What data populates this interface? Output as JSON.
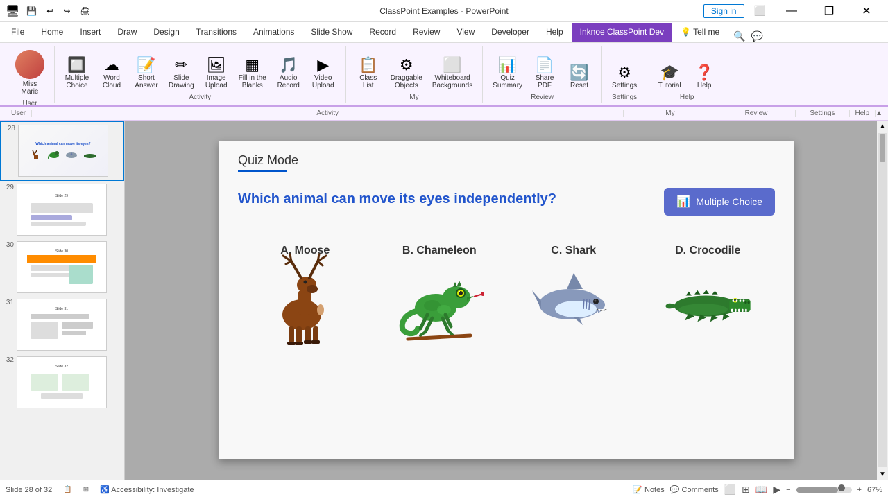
{
  "titlebar": {
    "title": "ClassPoint Examples - PowerPoint",
    "signIn": "Sign in",
    "buttons": {
      "minimize": "—",
      "maximize": "❐",
      "close": "✕"
    }
  },
  "quickaccess": [
    "💾",
    "↩",
    "↪",
    "🖨",
    "✎"
  ],
  "ribbon": {
    "activeTab": "Inknoe ClassPoint Dev",
    "tabs": [
      "File",
      "Home",
      "Insert",
      "Draw",
      "Design",
      "Transitions",
      "Animations",
      "Slide Show",
      "Record",
      "Review",
      "View",
      "Developer",
      "Help",
      "Inknoe ClassPoint Dev",
      "Tell me"
    ],
    "groups": {
      "user": {
        "label": "User",
        "items": [
          {
            "icon": "👤",
            "label": "Miss\nMarie"
          }
        ]
      },
      "activity": {
        "label": "Activity",
        "items": [
          {
            "icon": "🔲",
            "label": "Multiple\nChoice"
          },
          {
            "icon": "☁",
            "label": "Word\nCloud"
          },
          {
            "icon": "📝",
            "label": "Short\nAnswer"
          },
          {
            "icon": "✏",
            "label": "Slide\nDrawing"
          },
          {
            "icon": "🖼",
            "label": "Image\nUpload"
          },
          {
            "icon": "▦",
            "label": "Fill in the\nBlanks"
          },
          {
            "icon": "🎵",
            "label": "Audio\nRecord"
          },
          {
            "icon": "▶",
            "label": "Video\nUpload"
          }
        ]
      },
      "my": {
        "label": "My",
        "items": [
          {
            "icon": "📋",
            "label": "Class\nList"
          },
          {
            "icon": "⚙",
            "label": "Draggable\nObjects"
          },
          {
            "icon": "⬜",
            "label": "Whiteboard\nBackgrounds"
          }
        ]
      },
      "review": {
        "label": "Review",
        "items": [
          {
            "icon": "📊",
            "label": "Quiz\nSummary"
          },
          {
            "icon": "📄",
            "label": "Share\nPDF"
          },
          {
            "icon": "🔄",
            "label": "Reset"
          }
        ]
      },
      "settings": {
        "label": "Settings",
        "items": [
          {
            "icon": "⚙",
            "label": "Settings"
          }
        ]
      },
      "help": {
        "label": "Help",
        "items": [
          {
            "icon": "🎓",
            "label": "Tutorial"
          },
          {
            "icon": "❓",
            "label": "Help"
          }
        ]
      }
    }
  },
  "slidePanel": {
    "slides": [
      {
        "number": "28",
        "active": true
      },
      {
        "number": "29"
      },
      {
        "number": "30"
      },
      {
        "number": "31"
      },
      {
        "number": "32"
      }
    ]
  },
  "slide": {
    "quizModeLabel": "Quiz Mode",
    "question": "Which animal can move its eyes independently?",
    "multipleChoiceBtn": "Multiple Choice",
    "answers": [
      {
        "letter": "A.",
        "name": "Moose"
      },
      {
        "letter": "B.",
        "name": "Chameleon"
      },
      {
        "letter": "C.",
        "name": "Shark"
      },
      {
        "letter": "D.",
        "name": "Crocodile"
      }
    ]
  },
  "statusBar": {
    "slideInfo": "Slide 28 of 32",
    "accessibility": "Accessibility: Investigate",
    "notes": "Notes",
    "comments": "Comments",
    "zoom": "67%"
  }
}
